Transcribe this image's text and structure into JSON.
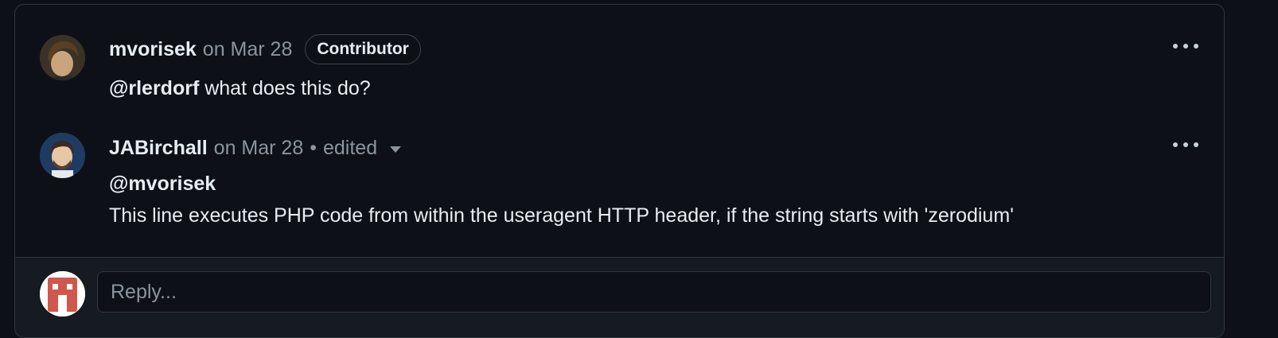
{
  "comments": [
    {
      "author": "mvorisek",
      "date": "on Mar 28",
      "badge": "Contributor",
      "body": {
        "mention": "@rlerdorf",
        "text": " what does this do?"
      }
    },
    {
      "author": "JABirchall",
      "date": "on Mar 28",
      "separator": "•",
      "edited": "edited",
      "body": {
        "mention": "@mvorisek",
        "text": "This line executes PHP code from within the useragent HTTP header, if the string starts with 'zerodium'"
      }
    }
  ],
  "reply": {
    "placeholder": "Reply..."
  },
  "icons": {
    "more": "kebab-horizontal-icon",
    "edited_dropdown": "triangle-down-icon"
  },
  "colors": {
    "background": "#0d1117",
    "border": "#30363d",
    "text_primary": "#e6edf3",
    "text_muted": "#8b949e",
    "reply_avatar": "#d0574b"
  }
}
